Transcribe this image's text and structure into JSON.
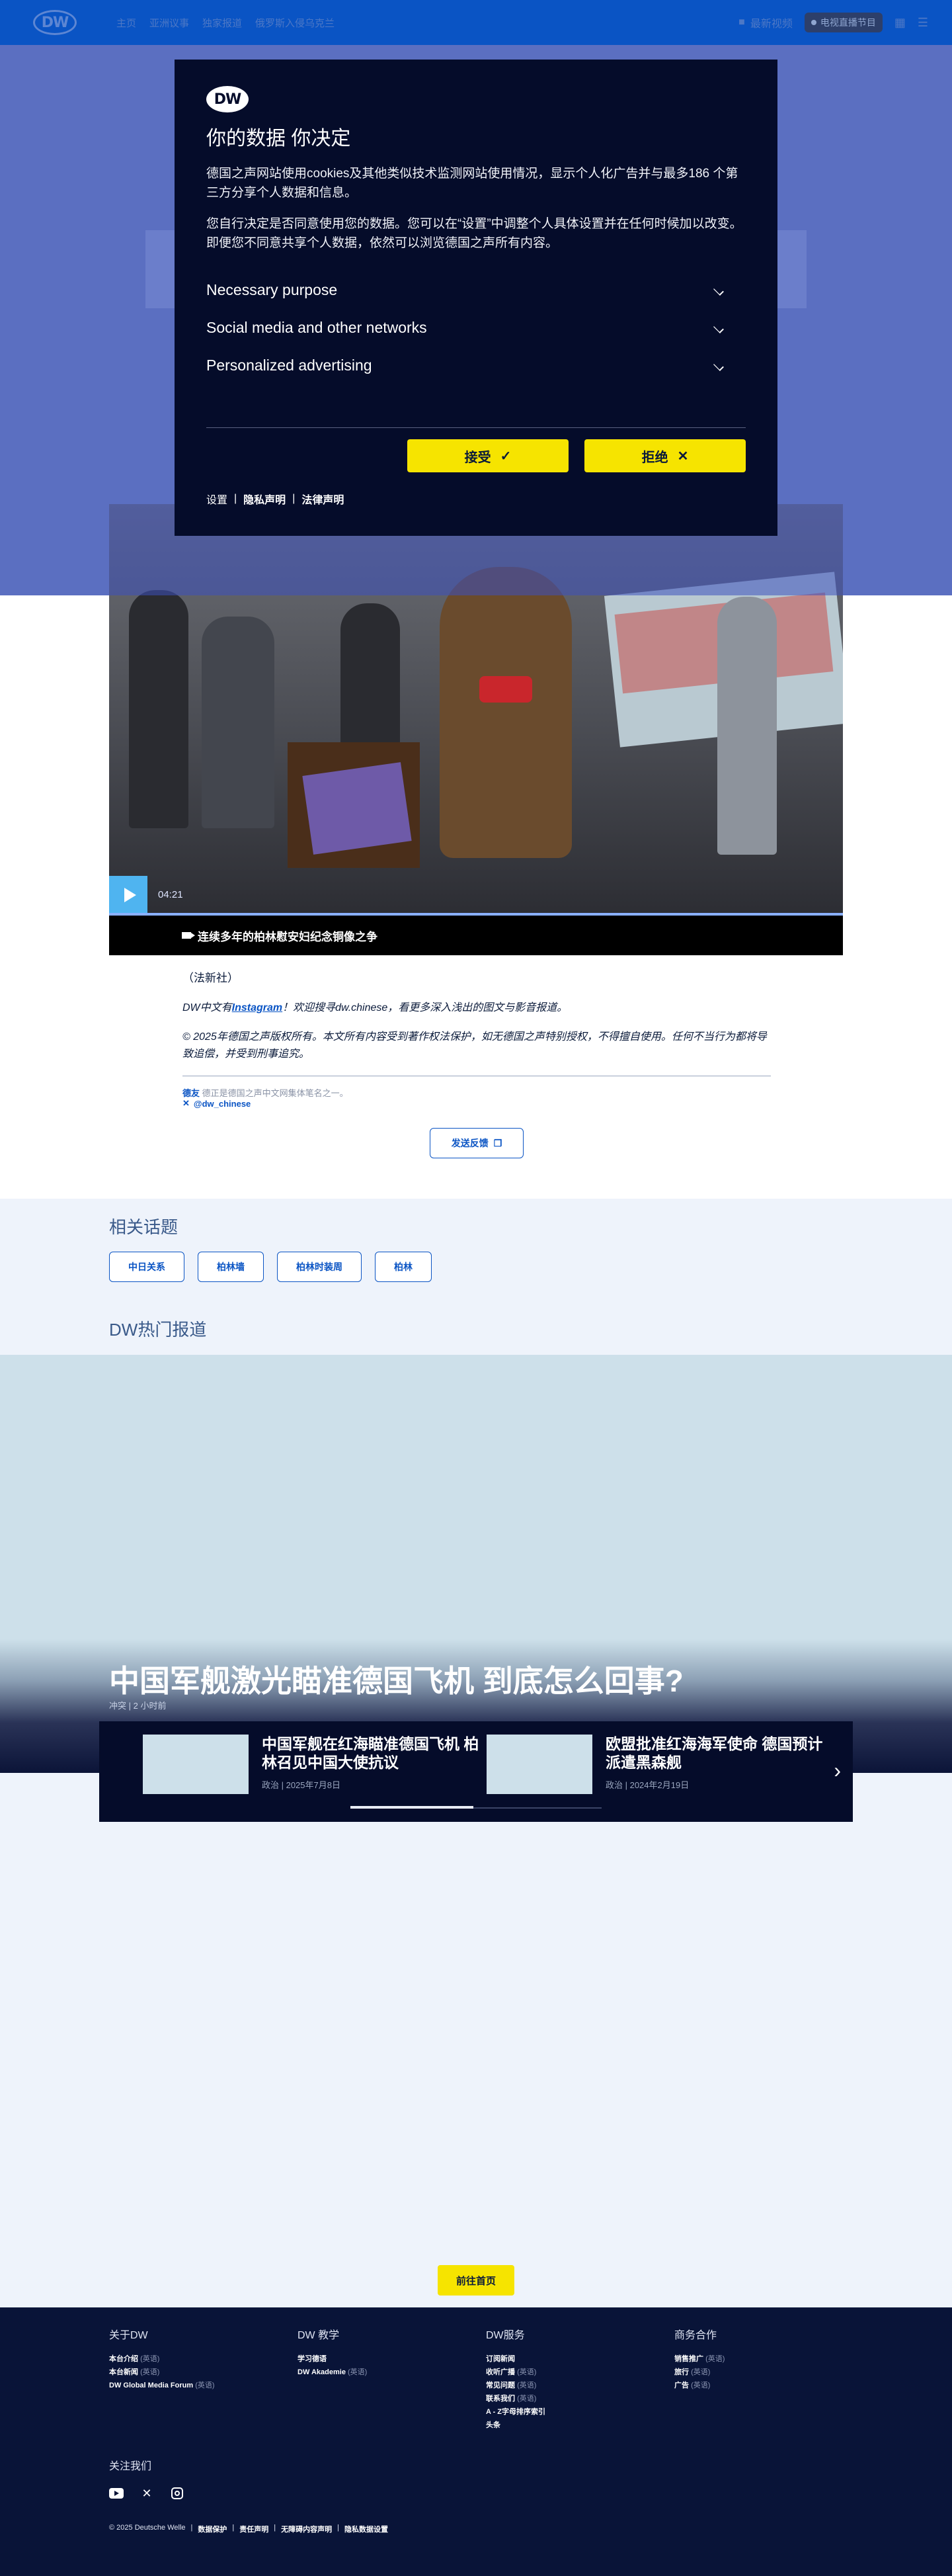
{
  "header": {
    "logo": "DW",
    "nav": [
      "主页",
      "亚洲议事",
      "独家报道",
      "俄罗斯入侵乌克兰"
    ],
    "latest_videos": "最新视频",
    "live": "电视直播节目"
  },
  "consent": {
    "logo": "DW",
    "title": "你的数据 你决定",
    "para1": "德国之声网站使用cookies及其他类似技术监测网站使用情况，显示个人化广告并与最多186 个第三方分享个人数据和信息。",
    "para2": "您自行决定是否同意使用您的数据。您可以在“设置”中调整个人具体设置并在任何时候加以改变。即便您不同意共享个人数据，依然可以浏览德国之声所有内容。",
    "sections": [
      "Necessary purpose",
      "Social media and other networks",
      "Personalized advertising"
    ],
    "accept": "接受",
    "reject": "拒绝",
    "links": {
      "settings": "设置",
      "privacy": "隐私声明",
      "legal": "法律声明"
    }
  },
  "video": {
    "duration": "04:21",
    "caption": "连续多年的柏林慰安妇纪念铜像之争"
  },
  "article": {
    "source": "（法新社）",
    "ig_prefix": "DW中文有",
    "ig_link": "Instagram",
    "ig_suffix": "！欢迎搜寻dw.chinese，看更多深入浅出的图文与影音报道。",
    "copyright": "© 2025年德国之声版权所有。本文所有内容受到著作权法保护，如无德国之声特别授权，不得擅自使用。任何不当行为都将导致追偿，并受到刑事追究。",
    "author_name": "德友",
    "author_rest": "德正是德国之声中文网集体笔名之一。",
    "twitter": "@dw_chinese",
    "feedback": "发送反馈"
  },
  "related": {
    "title": "相关话题",
    "tags": [
      "中日关系",
      "柏林墙",
      "柏林时装周",
      "柏林"
    ]
  },
  "hot": {
    "title": "DW热门报道",
    "hero_title": "中国军舰激光瞄准德国飞机 到底怎么回事?",
    "hero_meta": "冲突 | 2 小时前",
    "cards": [
      {
        "title": "中国军舰在红海瞄准德国飞机 柏林召见中国大使抗议",
        "meta": "政治 | 2025年7月8日"
      },
      {
        "title": "欧盟批准红海海军使命 德国预计派遣黑森舰",
        "meta": "政治 | 2024年2月19日"
      }
    ],
    "progress": 0.49
  },
  "home_button": "前往首页",
  "footer": {
    "columns": [
      {
        "title": "关于DW",
        "items": [
          [
            "本台介绍",
            "(英语)"
          ],
          [
            "本台新闻",
            "(英语)"
          ],
          [
            "DW Global Media Forum",
            "(英语)"
          ]
        ]
      },
      {
        "title": "DW 教学",
        "items": [
          [
            "学习德语",
            ""
          ],
          [
            "DW Akademie",
            "(英语)"
          ]
        ]
      },
      {
        "title": "DW服务",
        "items": [
          [
            "订阅新闻",
            ""
          ],
          [
            "收听广播",
            "(英语)"
          ],
          [
            "常见问题",
            "(英语)"
          ],
          [
            "联系我们",
            "(英语)"
          ],
          [
            "A - Z字母排序索引",
            ""
          ],
          [
            "头条",
            ""
          ]
        ]
      },
      {
        "title": "商务合作",
        "items": [
          [
            "销售推广",
            "(英语)"
          ],
          [
            "旅行",
            "(英语)"
          ],
          [
            "广告",
            "(英语)"
          ]
        ]
      }
    ],
    "follow": "关注我们",
    "legal": [
      "© 2025 Deutsche Welle",
      "数据保护",
      "责任声明",
      "无障碍内容声明",
      "隐私数据设置"
    ]
  }
}
